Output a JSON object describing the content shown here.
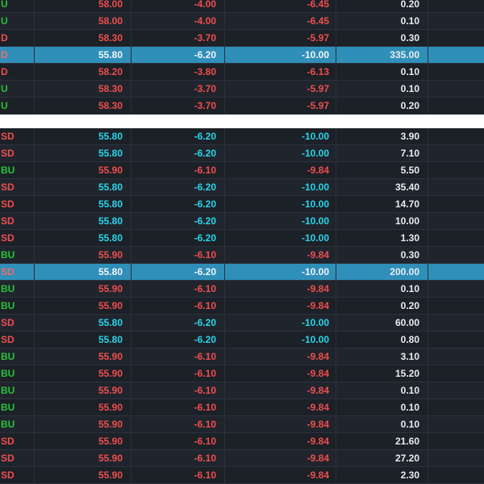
{
  "top_rows": [
    {
      "side": "U",
      "price": "58.00",
      "chg": "-4.00",
      "pct": "-6.45",
      "qty": "0.20",
      "hl": false
    },
    {
      "side": "U",
      "price": "58.00",
      "chg": "-4.00",
      "pct": "-6.45",
      "qty": "0.10",
      "hl": false
    },
    {
      "side": "D",
      "price": "58.30",
      "chg": "-3.70",
      "pct": "-5.97",
      "qty": "0.30",
      "hl": false
    },
    {
      "side": "D",
      "price": "55.80",
      "chg": "-6.20",
      "pct": "-10.00",
      "qty": "335.00",
      "hl": true
    },
    {
      "side": "D",
      "price": "58.20",
      "chg": "-3.80",
      "pct": "-6.13",
      "qty": "0.10",
      "hl": false
    },
    {
      "side": "U",
      "price": "58.30",
      "chg": "-3.70",
      "pct": "-5.97",
      "qty": "0.10",
      "hl": false
    },
    {
      "side": "U",
      "price": "58.30",
      "chg": "-3.70",
      "pct": "-5.97",
      "qty": "0.20",
      "hl": false
    }
  ],
  "bottom_rows": [
    {
      "side": "SD",
      "price": "55.80",
      "chg": "-6.20",
      "pct": "-10.00",
      "qty": "3.90",
      "hl": false
    },
    {
      "side": "SD",
      "price": "55.80",
      "chg": "-6.20",
      "pct": "-10.00",
      "qty": "7.10",
      "hl": false
    },
    {
      "side": "BU",
      "price": "55.90",
      "chg": "-6.10",
      "pct": "-9.84",
      "qty": "5.50",
      "hl": false
    },
    {
      "side": "SD",
      "price": "55.80",
      "chg": "-6.20",
      "pct": "-10.00",
      "qty": "35.40",
      "hl": false
    },
    {
      "side": "SD",
      "price": "55.80",
      "chg": "-6.20",
      "pct": "-10.00",
      "qty": "14.70",
      "hl": false
    },
    {
      "side": "SD",
      "price": "55.80",
      "chg": "-6.20",
      "pct": "-10.00",
      "qty": "10.00",
      "hl": false
    },
    {
      "side": "SD",
      "price": "55.80",
      "chg": "-6.20",
      "pct": "-10.00",
      "qty": "1.30",
      "hl": false
    },
    {
      "side": "BU",
      "price": "55.90",
      "chg": "-6.10",
      "pct": "-9.84",
      "qty": "0.30",
      "hl": false
    },
    {
      "side": "SD",
      "price": "55.80",
      "chg": "-6.20",
      "pct": "-10.00",
      "qty": "200.00",
      "hl": true
    },
    {
      "side": "BU",
      "price": "55.90",
      "chg": "-6.10",
      "pct": "-9.84",
      "qty": "0.10",
      "hl": false
    },
    {
      "side": "BU",
      "price": "55.90",
      "chg": "-6.10",
      "pct": "-9.84",
      "qty": "0.20",
      "hl": false
    },
    {
      "side": "SD",
      "price": "55.80",
      "chg": "-6.20",
      "pct": "-10.00",
      "qty": "60.00",
      "hl": false
    },
    {
      "side": "SD",
      "price": "55.80",
      "chg": "-6.20",
      "pct": "-10.00",
      "qty": "0.80",
      "hl": false
    },
    {
      "side": "BU",
      "price": "55.90",
      "chg": "-6.10",
      "pct": "-9.84",
      "qty": "3.10",
      "hl": false
    },
    {
      "side": "BU",
      "price": "55.90",
      "chg": "-6.10",
      "pct": "-9.84",
      "qty": "15.20",
      "hl": false
    },
    {
      "side": "BU",
      "price": "55.90",
      "chg": "-6.10",
      "pct": "-9.84",
      "qty": "0.10",
      "hl": false
    },
    {
      "side": "BU",
      "price": "55.90",
      "chg": "-6.10",
      "pct": "-9.84",
      "qty": "0.10",
      "hl": false
    },
    {
      "side": "BU",
      "price": "55.90",
      "chg": "-6.10",
      "pct": "-9.84",
      "qty": "0.10",
      "hl": false
    },
    {
      "side": "SD",
      "price": "55.90",
      "chg": "-6.10",
      "pct": "-9.84",
      "qty": "21.60",
      "hl": false
    },
    {
      "side": "SD",
      "price": "55.90",
      "chg": "-6.10",
      "pct": "-9.84",
      "qty": "27.20",
      "hl": false
    },
    {
      "side": "SD",
      "price": "55.90",
      "chg": "-6.10",
      "pct": "-9.84",
      "qty": "2.30",
      "hl": false
    }
  ],
  "colors": {
    "up": "#27c23a",
    "down": "#ef4e4e",
    "limit_down": "#29d5ea",
    "highlight": "#2f8fb9",
    "background": "#1b1f26"
  }
}
